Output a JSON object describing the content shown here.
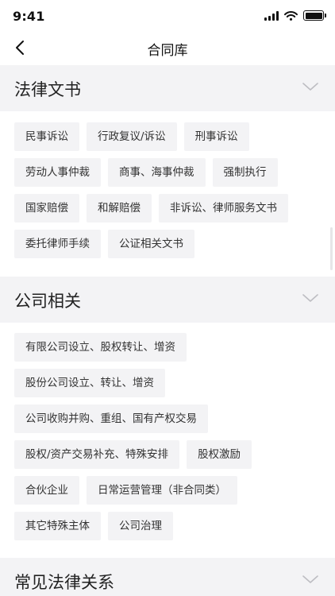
{
  "status_bar": {
    "time": "9:41"
  },
  "nav": {
    "title": "合同库"
  },
  "sections": [
    {
      "title": "法律文书",
      "tags": [
        "民事诉讼",
        "行政复议/诉讼",
        "刑事诉讼",
        "劳动人事仲裁",
        "商事、海事仲裁",
        "强制执行",
        "国家赔偿",
        "和解赔偿",
        "非诉讼、律师服务文书",
        "委托律师手续",
        "公证相关文书"
      ]
    },
    {
      "title": "公司相关",
      "tags": [
        "有限公司设立、股权转让、增资",
        "股份公司设立、转让、增资",
        "公司收购并购、重组、国有产权交易",
        "股权/资产交易补充、特殊安排",
        "股权激励",
        "合伙企业",
        "日常运营管理（非合同类）",
        "其它特殊主体",
        "公司治理"
      ]
    },
    {
      "title": "常见法律关系",
      "tags": []
    }
  ]
}
